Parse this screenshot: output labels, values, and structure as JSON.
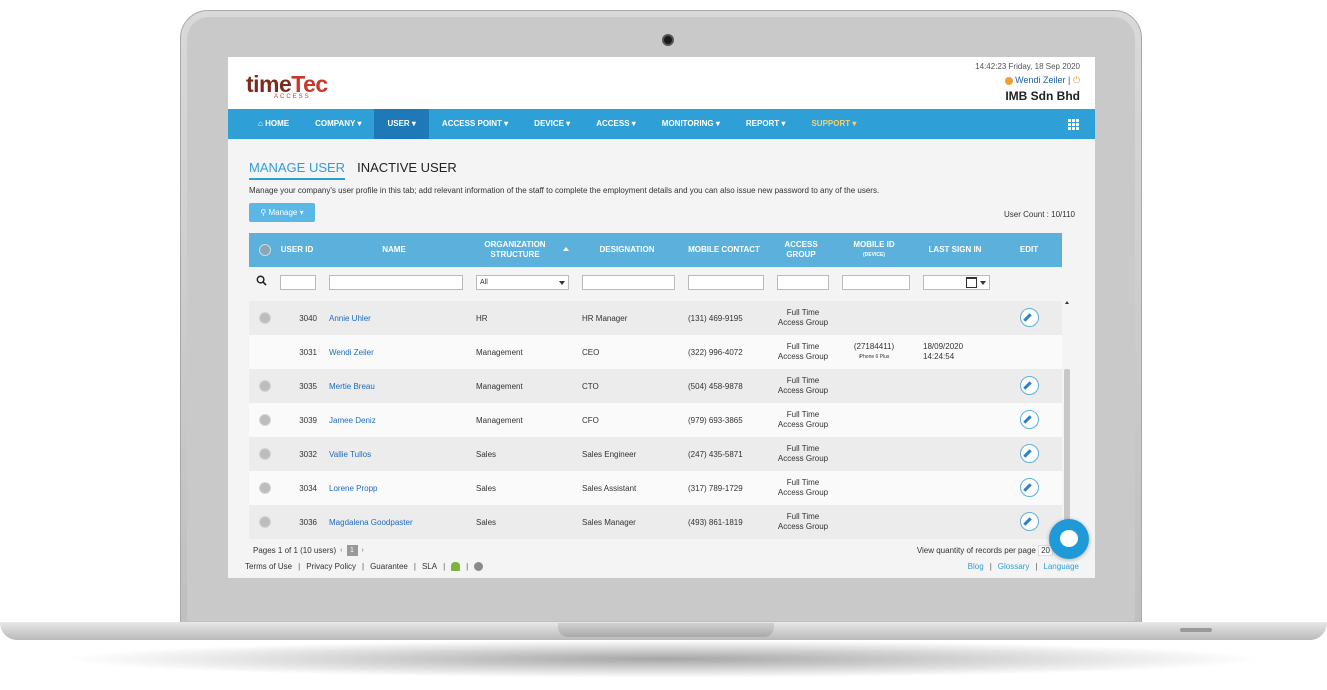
{
  "header": {
    "logo_time": "time",
    "logo_tec": "Tec",
    "logo_sub": "ACCESS",
    "datetime": "14:42:23 Friday, 18 Sep 2020",
    "user_name": "Wendi Zeiler",
    "user_sep": "|",
    "company": "IMB Sdn Bhd"
  },
  "nav": {
    "items": [
      "HOME",
      "COMPANY ▾",
      "USER ▾",
      "ACCESS POINT ▾",
      "DEVICE ▾",
      "ACCESS ▾",
      "MONITORING ▾",
      "REPORT ▾",
      "SUPPORT ▾"
    ],
    "home_icon": "home-icon",
    "grid_icon": "apps-grid-icon"
  },
  "tabs": [
    "MANAGE USER",
    "INACTIVE USER"
  ],
  "description": "Manage your company's user profile in this tab; add relevant information of the staff to complete the employment details and you can also issue new password to any of the users.",
  "manage_button": "Manage ▾",
  "user_count": "User Count : 10/110",
  "table": {
    "headers": {
      "user_id": "USER ID",
      "name": "NAME",
      "org": "ORGANIZATION STRUCTURE",
      "designation": "DESIGNATION",
      "mobile_contact": "MOBILE CONTACT",
      "access_group": "ACCESS GROUP",
      "mobile_id": "MOBILE ID",
      "mobile_id_sub": "(DEVICE)",
      "last_sign_in": "LAST SIGN IN",
      "edit": "EDIT"
    },
    "filter_select_value": "All",
    "rows": [
      {
        "id": "3040",
        "name": "Annie Uhler",
        "org": "HR",
        "designation": "HR Manager",
        "mobile": "(131) 469-9195",
        "ag1": "Full Time",
        "ag2": "Access Group",
        "mid": "",
        "mid_sub": "",
        "sign_date": "",
        "sign_time": "",
        "has_check": true,
        "has_edit": true
      },
      {
        "id": "3031",
        "name": "Wendi Zeiler",
        "org": "Management",
        "designation": "CEO",
        "mobile": "(322) 996-4072",
        "ag1": "Full Time",
        "ag2": "Access Group",
        "mid": "(27184411)",
        "mid_sub": "iPhone 6 Plus",
        "sign_date": "18/09/2020",
        "sign_time": "14:24:54",
        "has_check": false,
        "has_edit": false
      },
      {
        "id": "3035",
        "name": "Mertie Breau",
        "org": "Management",
        "designation": "CTO",
        "mobile": "(504) 458-9878",
        "ag1": "Full Time",
        "ag2": "Access Group",
        "mid": "",
        "mid_sub": "",
        "sign_date": "",
        "sign_time": "",
        "has_check": true,
        "has_edit": true
      },
      {
        "id": "3039",
        "name": "Jamee Deniz",
        "org": "Management",
        "designation": "CFO",
        "mobile": "(979) 693-3865",
        "ag1": "Full Time",
        "ag2": "Access Group",
        "mid": "",
        "mid_sub": "",
        "sign_date": "",
        "sign_time": "",
        "has_check": true,
        "has_edit": true
      },
      {
        "id": "3032",
        "name": "Vallie Tullos",
        "org": "Sales",
        "designation": "Sales Engineer",
        "mobile": "(247) 435-5871",
        "ag1": "Full Time",
        "ag2": "Access Group",
        "mid": "",
        "mid_sub": "",
        "sign_date": "",
        "sign_time": "",
        "has_check": true,
        "has_edit": true
      },
      {
        "id": "3034",
        "name": "Lorene Propp",
        "org": "Sales",
        "designation": "Sales Assistant",
        "mobile": "(317) 789-1729",
        "ag1": "Full Time",
        "ag2": "Access Group",
        "mid": "",
        "mid_sub": "",
        "sign_date": "",
        "sign_time": "",
        "has_check": true,
        "has_edit": true
      },
      {
        "id": "3036",
        "name": "Magdalena Goodpaster",
        "org": "Sales",
        "designation": "Sales Manager",
        "mobile": "(493) 861-1819",
        "ag1": "Full Time",
        "ag2": "Access Group",
        "mid": "",
        "mid_sub": "",
        "sign_date": "",
        "sign_time": "",
        "has_check": true,
        "has_edit": true
      }
    ]
  },
  "pager": {
    "text": "Pages 1 of 1 (10 users)",
    "page": "1",
    "prev": "‹",
    "next": "›"
  },
  "per_page": {
    "label": "View quantity of records per page",
    "value": "20"
  },
  "footer": {
    "left": [
      "Terms of Use",
      "Privacy Policy",
      "Guarantee",
      "SLA"
    ],
    "right": [
      "Blog",
      "Glossary",
      "Language"
    ],
    "sep": "|"
  },
  "colors": {
    "nav_bg": "#2f9fd8",
    "nav_active": "#1f79b8",
    "support_text": "#f5d36b",
    "table_header": "#5bb1dc",
    "link": "#1f6bbf",
    "chat": "#1f9ad9"
  }
}
